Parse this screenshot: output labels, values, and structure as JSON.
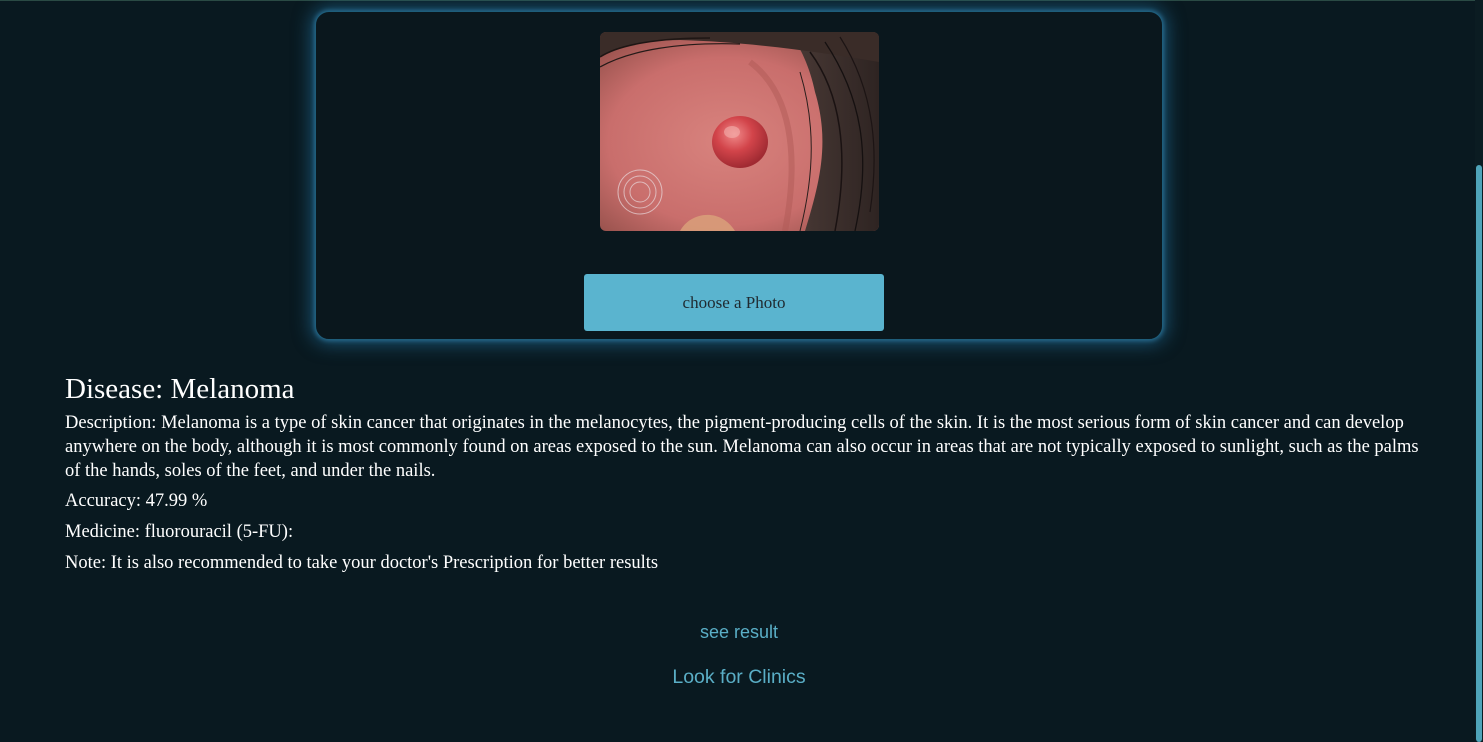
{
  "upload": {
    "image_alt": "uploaded skin lesion photo",
    "choose_label": "choose a Photo"
  },
  "result": {
    "disease": "Disease: Melanoma",
    "description": "Description: Melanoma is a type of skin cancer that originates in the melanocytes, the pigment-producing cells of the skin. It is the most serious form of skin cancer and can develop anywhere on the body, although it is most commonly found on areas exposed to the sun. Melanoma can also occur in areas that are not typically exposed to sunlight, such as the palms of the hands, soles of the feet, and under the nails.",
    "accuracy": "Accuracy: 47.99 %",
    "medicine": "Medicine: fluorouracil (5-FU):",
    "note": "Note: It is also recommended to take your doctor's Prescription for better results"
  },
  "links": {
    "see_result": "see result",
    "look_for_clinics": "Look for Clinics"
  },
  "colors": {
    "background": "#091920",
    "accent": "#5ab4cf",
    "link": "#5aaec6",
    "card_glow": "#2680b0"
  }
}
